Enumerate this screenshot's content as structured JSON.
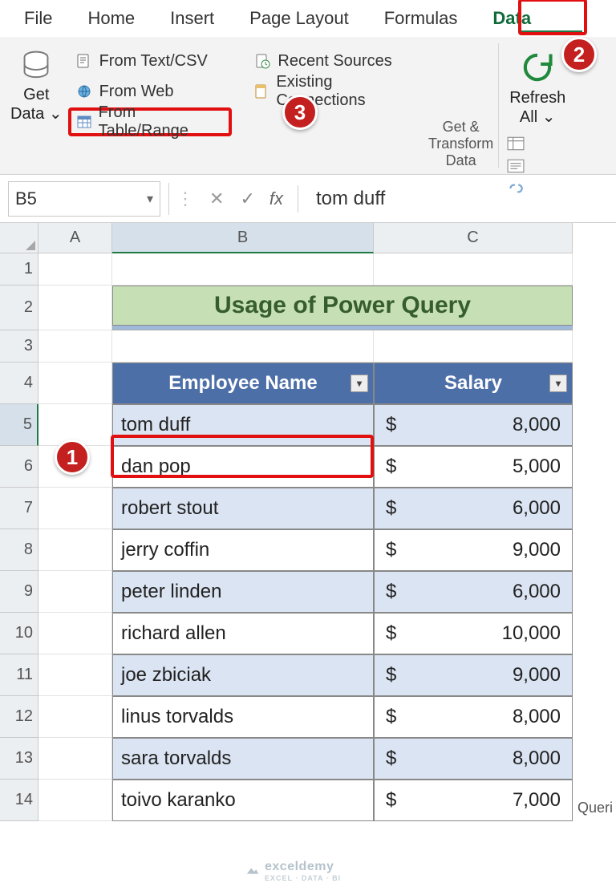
{
  "ribbon": {
    "tabs": [
      "File",
      "Home",
      "Insert",
      "Page Layout",
      "Formulas",
      "Data"
    ],
    "active_tab": "Data",
    "get_data_label_1": "Get",
    "get_data_label_2": "Data",
    "buttons": {
      "from_text_csv": "From Text/CSV",
      "from_web": "From Web",
      "from_table_range": "From Table/Range",
      "recent_sources": "Recent Sources",
      "existing_connections": "Existing Connections"
    },
    "refresh_label_1": "Refresh",
    "refresh_label_2": "All",
    "group_transform": "Get & Transform Data",
    "group_queries_partial": "Queri"
  },
  "formula_bar": {
    "name_box": "B5",
    "value": "tom duff"
  },
  "sheet": {
    "columns": [
      "A",
      "B",
      "C"
    ],
    "title": "Usage of Power Query",
    "headers": {
      "name": "Employee Name",
      "salary": "Salary"
    },
    "rows": [
      {
        "name": "tom duff",
        "cur": "$",
        "salary": "8,000"
      },
      {
        "name": "dan pop",
        "cur": "$",
        "salary": "5,000"
      },
      {
        "name": "robert stout",
        "cur": "$",
        "salary": "6,000"
      },
      {
        "name": "jerry coffin",
        "cur": "$",
        "salary": "9,000"
      },
      {
        "name": "peter linden",
        "cur": "$",
        "salary": "6,000"
      },
      {
        "name": "richard allen",
        "cur": "$",
        "salary": "10,000"
      },
      {
        "name": "joe zbiciak",
        "cur": "$",
        "salary": "9,000"
      },
      {
        "name": "linus torvalds",
        "cur": "$",
        "salary": "8,000"
      },
      {
        "name": "sara torvalds",
        "cur": "$",
        "salary": "8,000"
      },
      {
        "name": "toivo karanko",
        "cur": "$",
        "salary": "7,000"
      }
    ]
  },
  "callouts": {
    "b1": "1",
    "b2": "2",
    "b3": "3"
  },
  "watermark": {
    "brand": "exceldemy",
    "tag": "EXCEL · DATA · BI"
  },
  "chevron": "⌄",
  "caret": "▾",
  "check": "✓",
  "cross": "✕",
  "fx": "fx"
}
